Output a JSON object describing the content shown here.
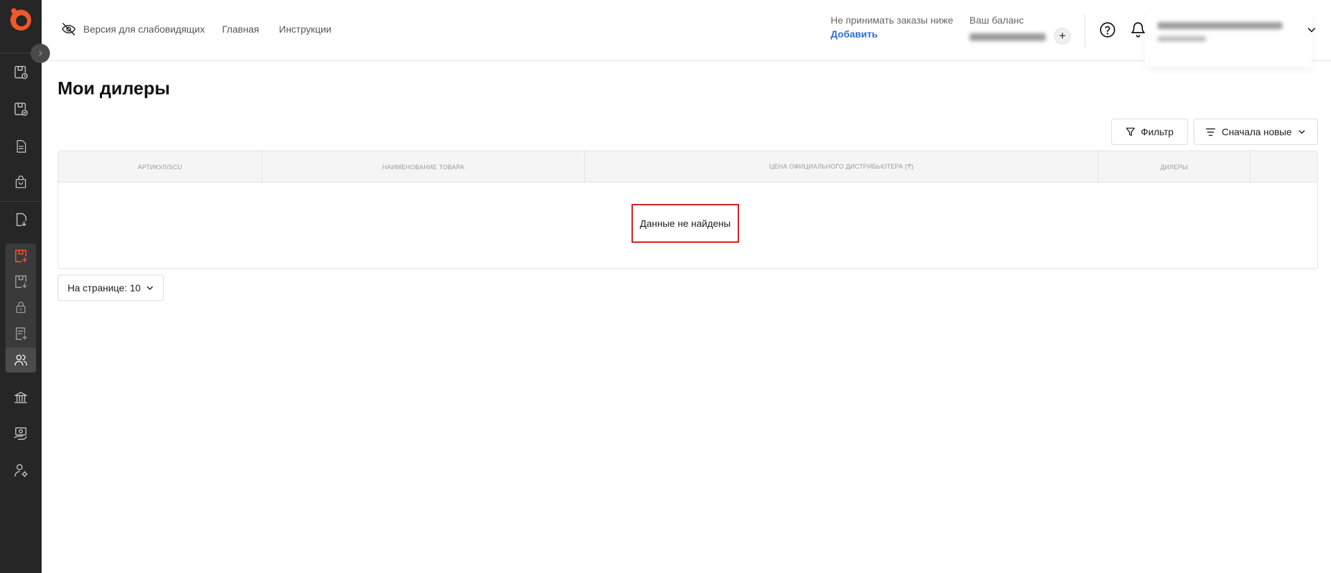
{
  "header": {
    "accessibility_label": "Версия для слабовидящих",
    "nav": [
      "Главная",
      "Инструкции"
    ],
    "min_order_label": "Не принимать заказы ниже",
    "min_order_action": "Добавить",
    "balance_label": "Ваш баланс",
    "balance_add": "+"
  },
  "sidebar": {
    "icons": [
      "orders-time-icon",
      "orders-check-icon",
      "document-icon",
      "bag-icon",
      "document-download-icon",
      "box-add-icon",
      "box-download-icon",
      "lock-icon",
      "document-plus-icon",
      "users-icon",
      "bank-icon",
      "cash-icon",
      "user-settings-icon"
    ],
    "active": "users-icon"
  },
  "main": {
    "title": "Мои дилеры",
    "filter_label": "Фильтр",
    "sort_label": "Сначала новые",
    "table": {
      "columns": [
        "АРТИКУЛ/SCU",
        "НАИМЕНОВАНИЕ ТОВАРА",
        "ЦЕНА ОФИЦИАЛЬНОГО ДИСТРИБЬЮТЕРА (₸)",
        "ДИЛЕРЫ",
        ""
      ],
      "rows": [],
      "empty_text": "Данные не найдены"
    },
    "per_page_label": "На странице: 10"
  },
  "colors": {
    "sidebar_bg": "#262626",
    "accent": "#f0582a",
    "link": "#2d6fd2",
    "highlight_border": "#d21f1f"
  }
}
